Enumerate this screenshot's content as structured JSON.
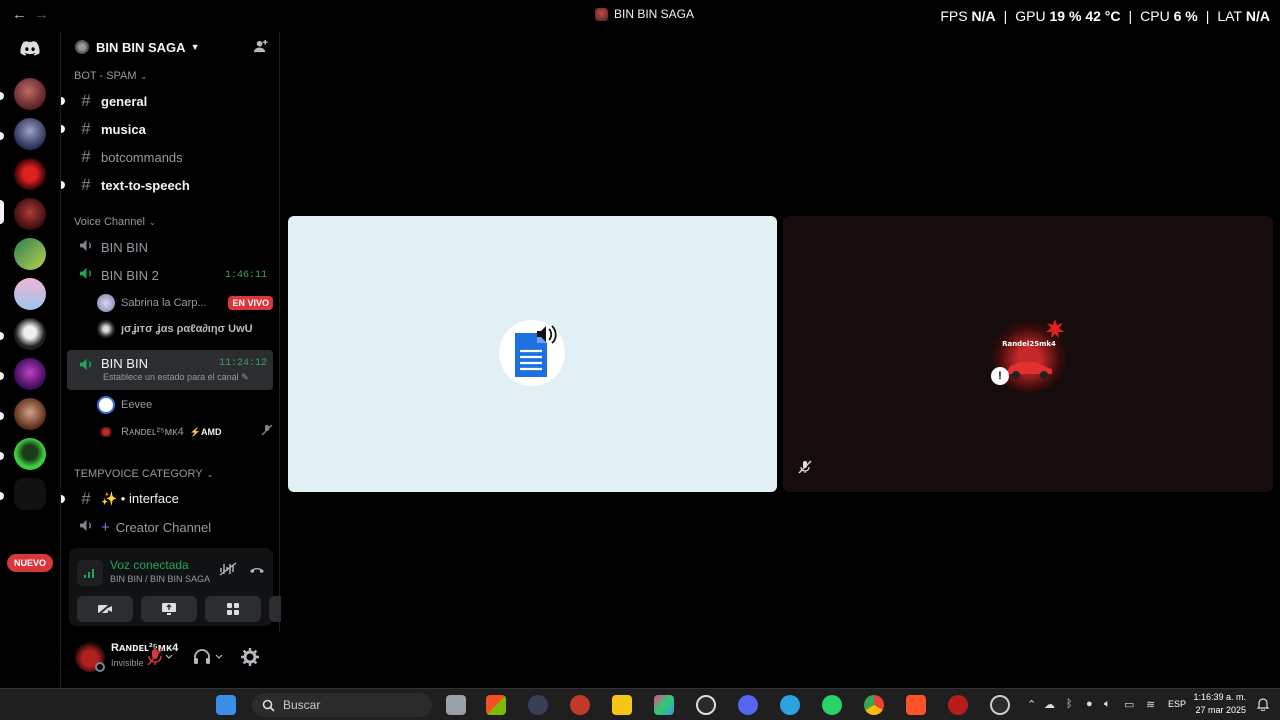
{
  "topbar": {
    "title": "BIN BIN SAGA",
    "perf": {
      "fps_label": "FPS",
      "fps_value": "N/A",
      "gpu_label": "GPU",
      "gpu_value": "19 %",
      "gpu_temp": "42 °C",
      "cpu_label": "CPU",
      "cpu_value": "6 %",
      "lat_label": "LAT",
      "lat_value": "N/A"
    }
  },
  "guild_rail": {
    "nuevo_label": "NUEVO"
  },
  "server": {
    "name": "BIN BIN SAGA"
  },
  "categories": {
    "bot_spam": "BOT - SPAM",
    "voice": "Voice Channel",
    "tempvoice": "TEMPVOICE CATEGORY"
  },
  "text_channels": [
    {
      "name": "general"
    },
    {
      "name": "musica"
    },
    {
      "name": "botcommands"
    },
    {
      "name": "text-to-speech"
    }
  ],
  "voice_channels": [
    {
      "name": "BIN BIN"
    },
    {
      "name": "BIN BIN 2",
      "timer": "1:46:11"
    },
    {
      "name": "BIN BIN",
      "timer": "11:24:12",
      "status": "Establece un estado para el canal"
    }
  ],
  "voice_users": {
    "bb2": [
      {
        "name": "Sabrina la Carp...",
        "badge": "EN VIVO"
      },
      {
        "name": "ȷσʝιтσ ʝαѕ ραℓα∂ιησ UwU"
      }
    ],
    "bb": [
      {
        "name": "Eevee"
      },
      {
        "name": "Rᴀɴᴅᴇʟ²⁵ᴍᴋ4",
        "tag": "⚡AMD"
      }
    ]
  },
  "tempvoice_channels": [
    {
      "name": "✨ • interface"
    },
    {
      "name": "Creator Channel"
    }
  ],
  "voice_panel": {
    "status": "Voz conectada",
    "location": "BIN BIN / BIN BIN SAGA"
  },
  "user_panel": {
    "name": "Rᴀɴᴅᴇʟ²⁵ᴍᴋ4",
    "status": "Invisible"
  },
  "stage": {
    "right_tile_tag": "Randel25mk4"
  },
  "taskbar": {
    "search_placeholder": "Buscar",
    "lang": "ESP",
    "time": "1:16:39 a. m.",
    "date": "27 mar 2025"
  },
  "colors": {
    "accent_green": "#23a55a",
    "live_red": "#da373c",
    "background": "#000000"
  }
}
